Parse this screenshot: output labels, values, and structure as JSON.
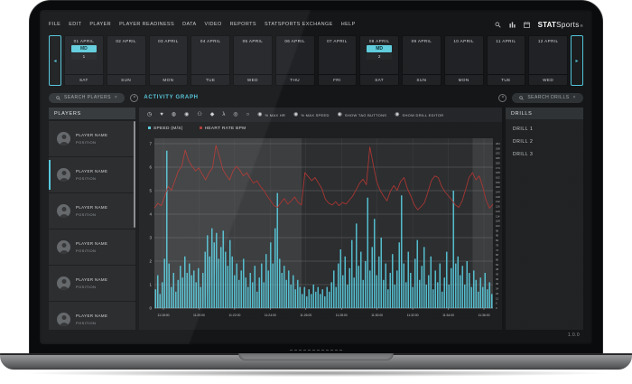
{
  "menu": {
    "items": [
      "FILE",
      "EDIT",
      "PLAYER",
      "PLAYER READINESS",
      "DATA",
      "VIDEO",
      "REPORTS",
      "STATSPORTS EXCHANGE",
      "HELP"
    ]
  },
  "header": {
    "icons": [
      "search-icon",
      "report-columns-icon",
      "calendar-icon"
    ],
    "logo": {
      "stat": "STAT",
      "sports": "Sports",
      "reg": "®"
    }
  },
  "carousel": {
    "prev": "◂",
    "next": "▸",
    "dates": [
      {
        "date": "01 APRIL",
        "day": "SAT",
        "md": true,
        "md_label": "MD",
        "session": "1"
      },
      {
        "date": "02 APRIL",
        "day": "SUN",
        "md": false
      },
      {
        "date": "03 APRIL",
        "day": "MON",
        "md": false
      },
      {
        "date": "04 APRIL",
        "day": "TUE",
        "md": false
      },
      {
        "date": "05 APRIL",
        "day": "WED",
        "md": false
      },
      {
        "date": "06 APRIL",
        "day": "THU",
        "md": false
      },
      {
        "date": "07 APRIL",
        "day": "FRI",
        "md": false
      },
      {
        "date": "08 APRIL",
        "day": "SAT",
        "md": true,
        "md_label": "MD",
        "session": "2"
      },
      {
        "date": "09 APRIL",
        "day": "SUN",
        "md": false
      },
      {
        "date": "10 APRIL",
        "day": "MON",
        "md": false
      },
      {
        "date": "11 APRIL",
        "day": "TUE",
        "md": false
      },
      {
        "date": "12 APRIL",
        "day": "WED",
        "md": false
      }
    ]
  },
  "subheader": {
    "search_players": "SEARCH PLAYERS",
    "search_drills": "SEARCH DRILLS",
    "clear": "×",
    "title": "ACTIVITY GRAPH"
  },
  "players_panel": {
    "title": "PLAYERS",
    "selected_index": 1,
    "items": [
      {
        "name": "PLAYER NAME",
        "position": "POSITION"
      },
      {
        "name": "PLAYER NAME",
        "position": "POSITION"
      },
      {
        "name": "PLAYER NAME",
        "position": "POSITION"
      },
      {
        "name": "PLAYER NAME",
        "position": "POSITION"
      },
      {
        "name": "PLAYER NAME",
        "position": "POSITION"
      },
      {
        "name": "PLAYER NAME",
        "position": "POSITION"
      }
    ]
  },
  "drills_panel": {
    "title": "DRILLS",
    "items": [
      "DRILL 1",
      "DRILL 2",
      "DRILL 3"
    ]
  },
  "toolbar": {
    "icons": [
      {
        "name": "gauge-icon",
        "glyph": "◷"
      },
      {
        "name": "heart-icon",
        "glyph": "♥"
      },
      {
        "name": "metabolic-icon",
        "glyph": "◍"
      },
      {
        "name": "impact-icon",
        "glyph": "◉"
      },
      {
        "name": "load-icon",
        "glyph": "⚇"
      },
      {
        "name": "diamond-icon",
        "glyph": "◆"
      },
      {
        "name": "runner-icon",
        "glyph": "λ"
      },
      {
        "name": "ball-icon",
        "glyph": "◎"
      },
      {
        "name": "circle-outline-icon",
        "glyph": "○"
      }
    ],
    "toggle_icon": "◉",
    "toggles": [
      "% MAX HR",
      "% MAX SPEED",
      "SHOW TAG BUTTONS",
      "SHOW DRILL EDITOR"
    ]
  },
  "version": "1.0.0",
  "chart_data": {
    "type": "line",
    "title": "",
    "grid": true,
    "legend_position": "top-left",
    "left_axis": {
      "label": "",
      "min": 0,
      "max": 7,
      "step": 1
    },
    "right_axis": {
      "label": "",
      "min": 0,
      "max": 204,
      "step": 6
    },
    "x_ticks": [
      "11:18:00",
      "11:20:00",
      "11:22:00",
      "11:24:00",
      "11:26:00",
      "11:28:00",
      "11:30:00",
      "11:32:00",
      "11:34:00",
      "11:36:00"
    ],
    "highlight_regions": [
      {
        "from": 0.0,
        "to": 0.435
      },
      {
        "from": 0.94,
        "to": 1.0
      }
    ],
    "series": [
      {
        "name": "SPEED (M/S)",
        "style": "bar",
        "axis": "left",
        "color": "#56c6d8",
        "values": [
          0.8,
          1.4,
          0.6,
          1.1,
          2.1,
          6.7,
          1.9,
          0.9,
          1.5,
          0.7,
          1.2,
          1.8,
          1.3,
          2.2,
          1.5,
          1.9,
          1.4,
          1.6,
          1.1,
          1.7,
          0.9,
          1.5,
          2.4,
          3.1,
          2.2,
          3.4,
          2.8,
          3.2,
          2.1,
          2.6,
          3.3,
          2.4,
          1.8,
          2.9,
          2.2,
          1.4,
          1.9,
          1.2,
          1.6,
          2.1,
          1.3,
          0.9,
          1.5,
          1.1,
          1.8,
          0.7,
          1.3,
          1.9,
          1.1,
          2.3,
          1.6,
          2.8,
          1.9,
          3.4,
          4.9,
          2.1,
          1.5,
          1.8,
          1.2,
          1.6,
          1.0,
          1.4,
          0.8,
          1.2,
          0.9,
          0.6,
          0.9,
          0.5,
          0.8,
          0.6,
          1.0,
          0.7,
          0.9,
          0.6,
          0.8,
          0.5,
          0.9,
          0.7,
          1.1,
          1.6,
          0.9,
          1.9,
          2.5,
          1.4,
          2.2,
          1.0,
          1.7,
          2.9,
          1.3,
          3.6,
          1.8,
          2.4,
          1.2,
          2.0,
          4.7,
          1.6,
          2.6,
          3.8,
          1.4,
          2.2,
          3.0,
          1.2,
          1.9,
          0.8,
          1.5,
          2.3,
          1.0,
          1.6,
          2.8,
          4.8,
          1.9,
          1.1,
          2.4,
          1.5,
          0.9,
          2.1,
          2.9,
          1.2,
          1.8,
          2.6,
          1.0,
          1.4,
          2.2,
          0.8,
          1.6,
          1.1,
          1.9,
          0.7,
          1.3,
          2.4,
          1.0,
          1.7,
          5.0,
          1.9,
          2.2,
          1.4,
          1.8,
          1.0,
          2.0,
          1.5,
          0.9,
          1.6,
          1.2,
          0.7,
          1.3,
          0.9,
          1.5,
          0.8,
          1.1,
          0.6
        ]
      },
      {
        "name": "HEART RATE BPM",
        "style": "line",
        "axis": "right",
        "color": "#a83430",
        "values": [
          124,
          130,
          127,
          139,
          151,
          146,
          158,
          170,
          176,
          196,
          183,
          176,
          170,
          174,
          166,
          159,
          168,
          174,
          202,
          188,
          172,
          165,
          159,
          170,
          176,
          171,
          164,
          168,
          161,
          155,
          158,
          151,
          146,
          139,
          133,
          127,
          125,
          131,
          136,
          129,
          133,
          138,
          131,
          128,
          168,
          163,
          158,
          162,
          155,
          148,
          135,
          130,
          128,
          132,
          127,
          131,
          129,
          134,
          139,
          147,
          155,
          160,
          153,
          200,
          178,
          157,
          146,
          139,
          133,
          145,
          152,
          146,
          157,
          162,
          148,
          139,
          128,
          122,
          126,
          131,
          144,
          158,
          164,
          162,
          151,
          144,
          139,
          134,
          128,
          125,
          133,
          147,
          162,
          168,
          159,
          164,
          151,
          134,
          124,
          129
        ]
      }
    ]
  }
}
